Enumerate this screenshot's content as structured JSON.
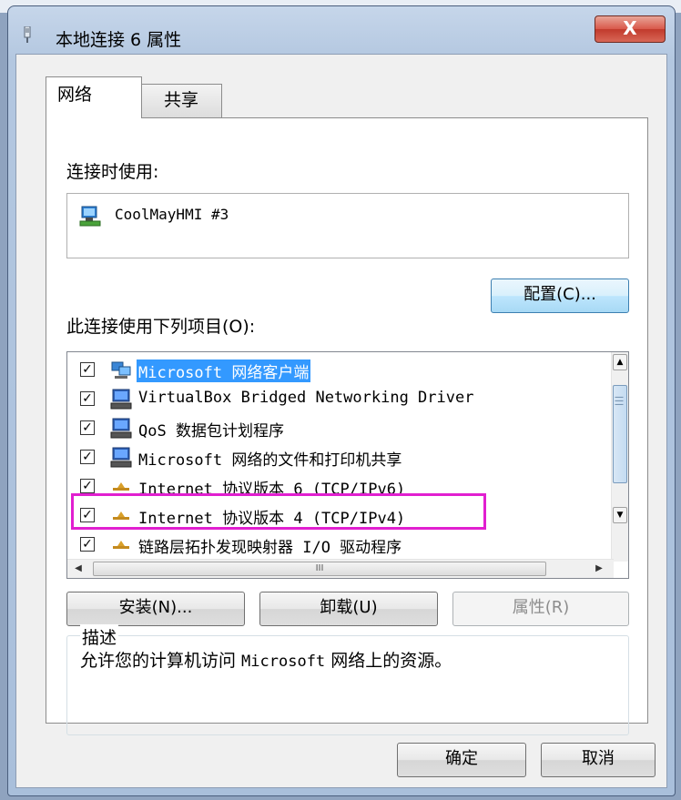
{
  "background_strip": {
    "text": ""
  },
  "window": {
    "title": "本地连接 6 属性",
    "close_label": "X"
  },
  "tabs": [
    {
      "label": "网络",
      "active": true
    },
    {
      "label": "共享",
      "active": false
    }
  ],
  "connect_using": {
    "label": "连接时使用:",
    "adapter": "CoolMayHMI #3",
    "configure_button": "配置(C)..."
  },
  "items_section": {
    "label": "此连接使用下列项目(O):",
    "items": [
      {
        "label": "Microsoft 网络客户端",
        "checked": true,
        "selected": true,
        "icon": "network-client-icon"
      },
      {
        "label": "VirtualBox Bridged Networking Driver",
        "checked": true,
        "selected": false,
        "icon": "computer-service-icon"
      },
      {
        "label": "QoS 数据包计划程序",
        "checked": true,
        "selected": false,
        "icon": "computer-service-icon"
      },
      {
        "label": "Microsoft 网络的文件和打印机共享",
        "checked": true,
        "selected": false,
        "icon": "computer-service-icon"
      },
      {
        "label": "Internet 协议版本 6 (TCP/IPv6)",
        "checked": true,
        "selected": false,
        "icon": "protocol-icon"
      },
      {
        "label": "Internet 协议版本 4 (TCP/IPv4)",
        "checked": true,
        "selected": false,
        "icon": "protocol-icon"
      },
      {
        "label": "链路层拓扑发现映射器 I/O 驱动程序",
        "checked": true,
        "selected": false,
        "icon": "protocol-icon"
      }
    ],
    "scroll_grip": "III"
  },
  "action_buttons": {
    "install": "安装(N)...",
    "uninstall": "卸载(U)",
    "properties": "属性(R)"
  },
  "description": {
    "title": "描述",
    "text_prefix": "允许您的计算机访问 ",
    "text_mono": "Microsoft",
    "text_suffix": " 网络上的资源。"
  },
  "dialog_buttons": {
    "ok": "确定",
    "cancel": "取消"
  },
  "colors": {
    "highlight_border": "#e11fd0",
    "selection": "#3399ff",
    "close_button": "#c13a2c"
  }
}
